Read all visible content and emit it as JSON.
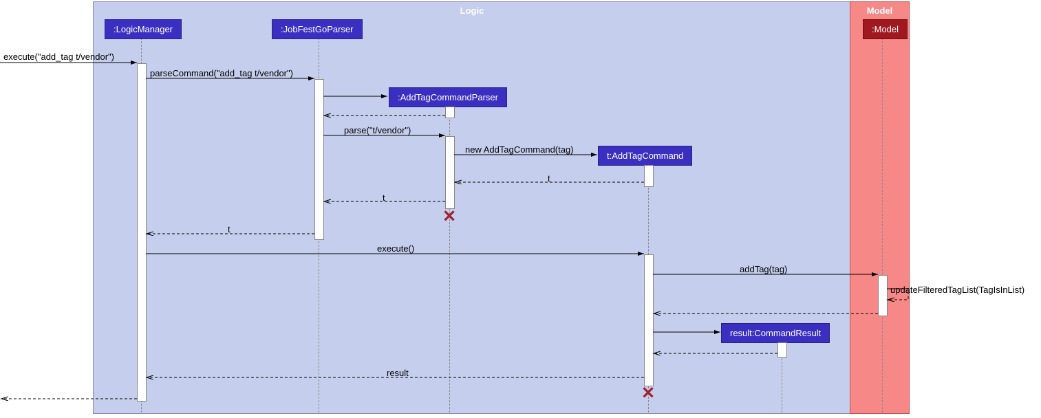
{
  "boxes": {
    "logic": "Logic",
    "model": "Model"
  },
  "participants": {
    "logicManager": ":LogicManager",
    "jobFestGoParser": ":JobFestGoParser",
    "addTagCommandParser": ":AddTagCommandParser",
    "addTagCommand": "t:AddTagCommand",
    "commandResult": "result:CommandResult",
    "model": ":Model"
  },
  "messages": {
    "m1": "execute(\"add_tag t/vendor\")",
    "m2": "parseCommand(\"add_tag t/vendor\")",
    "m3": "parse(\"t/vendor\")",
    "m4": "new AddTagCommand(tag)",
    "m5": "t",
    "m6": "t",
    "m7": "t",
    "m8": "execute()",
    "m9": "addTag(tag)",
    "m10": "updateFilteredTagList(TagIsInList)",
    "m11": "result"
  }
}
